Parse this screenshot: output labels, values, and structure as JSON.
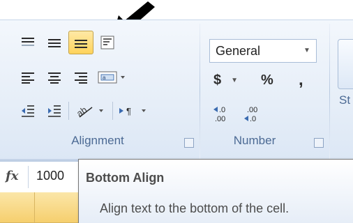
{
  "alignment_group": {
    "label": "Alignment",
    "row1": [
      "top-align-icon",
      "middle-align-icon",
      "bottom-align-icon",
      "wrap-text-icon"
    ],
    "row2": [
      "align-left-icon",
      "center-icon",
      "align-right-icon",
      "merge-center-icon"
    ],
    "row3": [
      "decrease-indent-icon",
      "increase-indent-icon",
      "orientation-icon",
      "text-direction-icon"
    ],
    "active_button": "bottom-align-icon"
  },
  "number_group": {
    "label": "Number",
    "format_value": "General",
    "currency_symbol": "$",
    "percent_symbol": "%",
    "comma_symbol": ",",
    "increase_decimal": ".0 .00",
    "decrease_decimal": ".00 .0"
  },
  "styles_group": {
    "label_partial": "St"
  },
  "formula_bar": {
    "fx_label": "fx",
    "value_partial": "1000"
  },
  "tooltip": {
    "title": "Bottom Align",
    "description": "Align text to the bottom of the cell."
  },
  "colors": {
    "active_button": "#ffd35b",
    "group_label": "#4c6a94",
    "header_highlight": "#f6cf6e"
  }
}
